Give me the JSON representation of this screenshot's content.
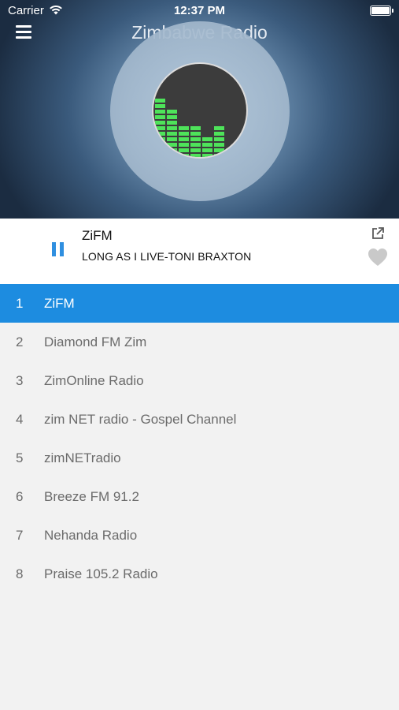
{
  "status_bar": {
    "carrier": "Carrier",
    "time": "12:37 PM"
  },
  "header": {
    "title": "Zimbabwe Radio"
  },
  "player": {
    "station": "ZiFM",
    "track": "LONG AS I LIVE-TONI BRAXTON",
    "state": "playing",
    "accent_color": "#2f8fe0"
  },
  "stations": [
    {
      "num": "1",
      "name": "ZiFM",
      "active": true
    },
    {
      "num": "2",
      "name": "Diamond FM Zim"
    },
    {
      "num": "3",
      "name": "ZimOnline Radio"
    },
    {
      "num": "4",
      "name": "zim NET radio - Gospel Channel"
    },
    {
      "num": "5",
      "name": "zimNETradio"
    },
    {
      "num": "6",
      "name": "Breeze FM 91.2"
    },
    {
      "num": "7",
      "name": "Nehanda Radio"
    },
    {
      "num": "8",
      "name": "Praise 105.2 Radio"
    }
  ],
  "colors": {
    "selected_row": "#1d8ce0",
    "list_text": "#6b6b6b",
    "equalizer": "#4ee35a"
  },
  "icons": [
    "wifi-icon",
    "battery-icon",
    "menu-icon",
    "pause-icon",
    "share-icon",
    "heart-icon",
    "equalizer-icon"
  ]
}
